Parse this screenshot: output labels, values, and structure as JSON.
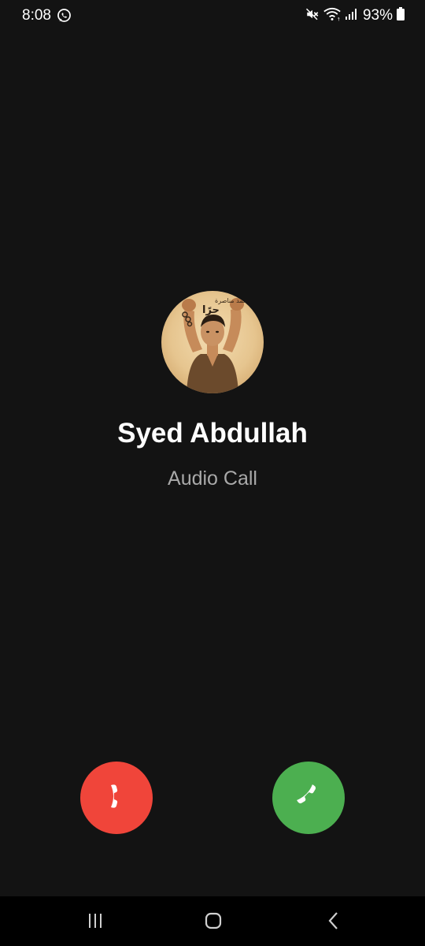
{
  "status_bar": {
    "time": "8:08",
    "battery_percent": "93%",
    "icons": [
      "whatsapp-icon",
      "mute-icon",
      "wifi-icon",
      "signal-icon",
      "battery-icon"
    ]
  },
  "caller": {
    "name": "Syed Abdullah",
    "call_type": "Audio Call",
    "avatar": {
      "arabic_text_line1": "أحمد مناصرة",
      "arabic_text_line2": "حرًا"
    }
  },
  "actions": {
    "decline": {
      "icon": "phone-decline-icon",
      "color": "#f0453a"
    },
    "accept": {
      "icon": "phone-accept-icon",
      "color": "#4caf50"
    }
  },
  "nav_bar": {
    "buttons": [
      "recents-icon",
      "home-icon",
      "back-icon"
    ]
  },
  "colors": {
    "background": "#131313",
    "text_primary": "#ffffff",
    "text_secondary": "#a9a9a9"
  }
}
